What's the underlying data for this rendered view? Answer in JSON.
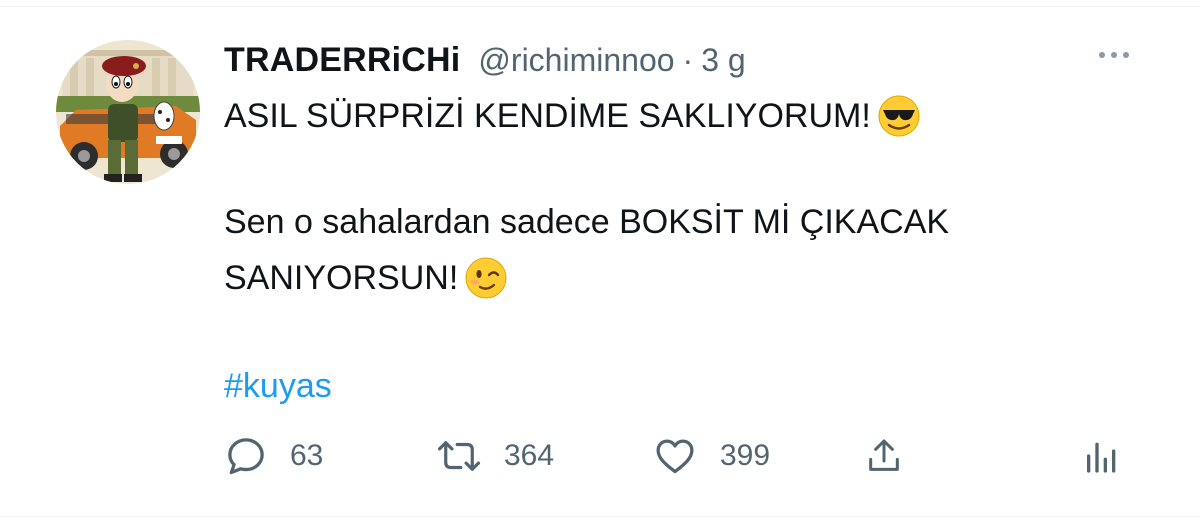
{
  "tweet": {
    "display_name": "TRADERRiCHi",
    "handle": "@richiminnoo",
    "separator": "·",
    "time": "3 g",
    "text": {
      "line1": "ASIL SÜRPRİZİ KENDİME SAKLIYORUM!",
      "line2": "Sen o sahalardan sadece BOKSİT Mİ ÇIKACAK",
      "line3": "SANIYORSUN!"
    },
    "emojis": [
      "smiling-face-with-sunglasses",
      "winking-face"
    ],
    "hashtag": "#kuyas"
  },
  "actions": {
    "reply_count": "63",
    "retweet_count": "364",
    "like_count": "399"
  },
  "icons": [
    "more-icon",
    "reply-icon",
    "retweet-icon",
    "like-icon",
    "share-icon",
    "analytics-icon"
  ],
  "colors": {
    "link": "#1d9bf0",
    "secondary_text": "#536471",
    "primary_text": "#0f1419"
  }
}
